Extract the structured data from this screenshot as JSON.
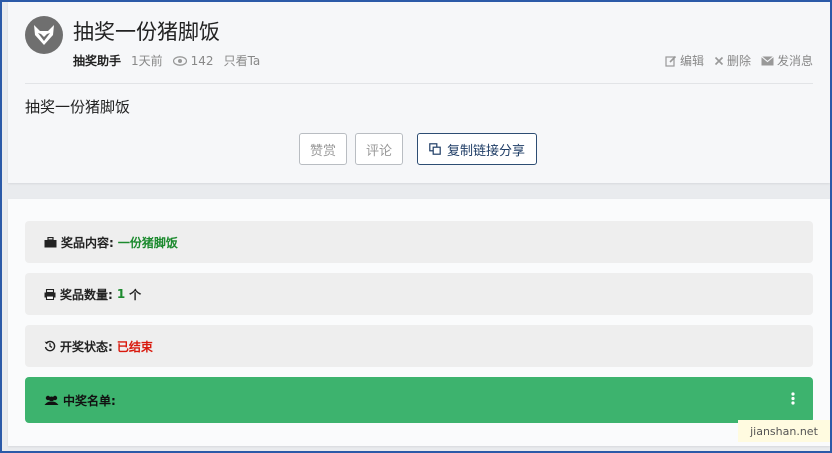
{
  "post": {
    "title": "抽奖一份猪脚饭",
    "author": "抽奖助手",
    "time": "1天前",
    "views": "142",
    "only_view": "只看Ta",
    "content": "抽奖一份猪脚饭",
    "actions": {
      "edit": "编辑",
      "delete": "删除",
      "message": "发消息"
    },
    "buttons": {
      "reward": "赞赏",
      "comment": "评论",
      "share": "复制链接分享"
    }
  },
  "prize": {
    "content_label": "奖品内容:",
    "content_value": "一份猪脚饭",
    "quantity_label": "奖品数量:",
    "quantity_value": "1",
    "quantity_unit": "个",
    "status_label": "开奖状态:",
    "status_value": "已结束",
    "winners_label": "中奖名单:"
  },
  "watermark": "jianshan.net",
  "colors": {
    "winners_bar": "#3db36e",
    "green_text": "#1c8a2e",
    "red_text": "#d9190d"
  },
  "icons": {
    "avatar": "fox-logo-icon",
    "views": "eye-icon",
    "edit": "edit-icon",
    "delete": "close-icon",
    "message": "envelope-icon",
    "share": "copy-icon",
    "content": "briefcase-icon",
    "quantity": "print-icon",
    "status": "history-icon",
    "winners": "users-icon",
    "more": "ellipsis-vertical-icon"
  }
}
